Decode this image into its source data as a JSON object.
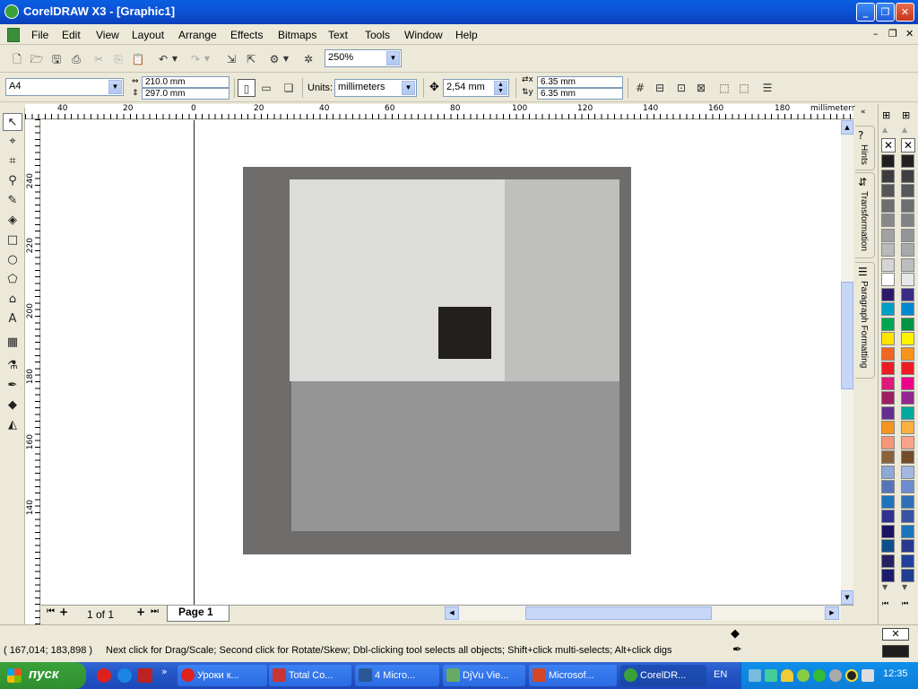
{
  "window": {
    "title": "CorelDRAW X3 - [Graphic1]"
  },
  "menu": [
    "File",
    "Edit",
    "View",
    "Layout",
    "Arrange",
    "Effects",
    "Bitmaps",
    "Text",
    "Tools",
    "Window",
    "Help"
  ],
  "standard_toolbar": {
    "zoom": "250%"
  },
  "property_bar": {
    "paper": "A4",
    "width": "210.0 mm",
    "height": "297.0 mm",
    "units_label": "Units:",
    "units": "millimeters",
    "nudge": "2,54 mm",
    "dup_x": "6.35 mm",
    "dup_y": "6.35 mm"
  },
  "ruler": {
    "h_labels": [
      "40",
      "20",
      "0",
      "20",
      "40",
      "60",
      "80",
      "100",
      "120",
      "140",
      "160",
      "180"
    ],
    "v_labels": [
      "240",
      "220",
      "200",
      "180",
      "160",
      "140"
    ],
    "units": "millimeters"
  },
  "docker_tabs": [
    "Hints",
    "Transformation",
    "Paragraph Formatting"
  ],
  "page_nav": {
    "count": "1 of 1",
    "page_tab": "Page 1"
  },
  "status": {
    "coords": "( 167,014; 183,898 )",
    "message": "Next click for Drag/Scale; Second click for Rotate/Skew; Dbl-clicking tool selects all objects; Shift+click multi-selects; Alt+click digs"
  },
  "drawing": {
    "outer_color": "#6E6D6B",
    "top_left_color": "#DCDCDA",
    "top_right_color": "#BFBFBD",
    "bottom_color": "#959595",
    "small_square_color": "#221F1C"
  },
  "palette": {
    "col1": [
      "#1E1E1E",
      "#3D3D3D",
      "#565656",
      "#6E6E6E",
      "#898989",
      "#A2A2A2",
      "#BABABA",
      "#D4D4D4",
      "#FFFFFF",
      "#2E1A6B",
      "#00A0C6",
      "#00A650",
      "#FFE400",
      "#F26522",
      "#ED1C24",
      "#E0177C",
      "#9E1F63",
      "#662D91",
      "#F7941D",
      "#F69679",
      "#8C6239",
      "#8FA9D6",
      "#5674B9",
      "#1E73BE",
      "#2E3192",
      "#1B1464",
      "#0D4F8B",
      "#262262",
      "#1C1C6E"
    ],
    "col2": [
      "#231F20",
      "#414042",
      "#58595B",
      "#6D6E71",
      "#808285",
      "#939598",
      "#A7A9AC",
      "#BCBEC0",
      "#E6E7E8",
      "#3B2C85",
      "#0089CF",
      "#009444",
      "#FFF200",
      "#F7941D",
      "#ED1C24",
      "#EC008C",
      "#92278F",
      "#00A99D",
      "#FBB040",
      "#F9A38B",
      "#754C29",
      "#A3B7E0",
      "#6C8CCF",
      "#2E70B7",
      "#3953A4",
      "#1B75BB",
      "#2B388F",
      "#21409A",
      "#1D3F8E"
    ]
  },
  "taskbar": {
    "start": "пуск",
    "tasks": [
      "Уроки к...",
      "Total Co...",
      "4 Micro...",
      "DjVu Vie...",
      "Microsof...",
      "CorelDR..."
    ],
    "lang": "EN",
    "clock": "12:35"
  }
}
